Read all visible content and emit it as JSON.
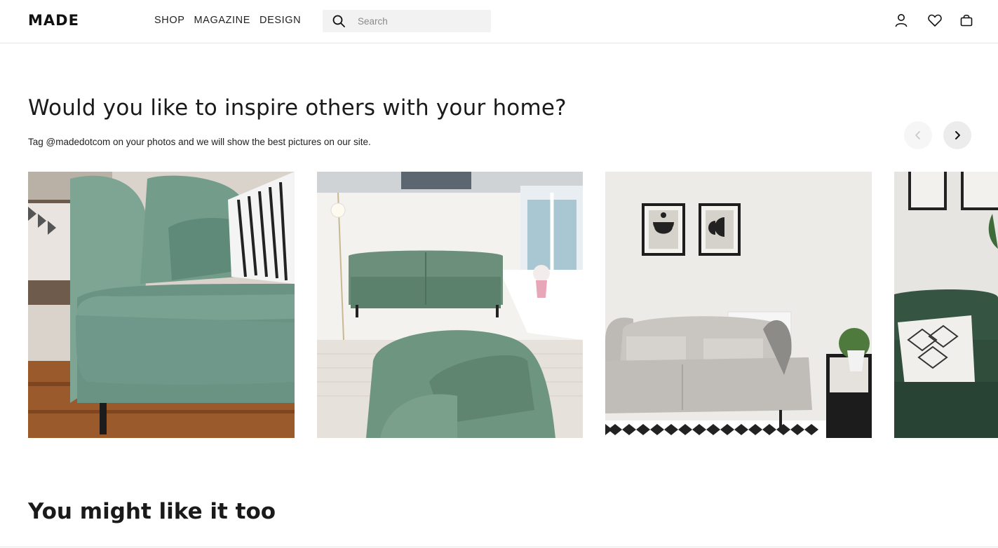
{
  "brand": {
    "logo": "MADE"
  },
  "nav": {
    "items": [
      "SHOP",
      "MAGAZINE",
      "DESIGN"
    ]
  },
  "search": {
    "placeholder": "Search",
    "value": ""
  },
  "header_icons": [
    "account-icon",
    "wishlist-heart-icon",
    "basket-icon"
  ],
  "inspire": {
    "title": "Would you like to inspire others with your home?",
    "subtitle": "Tag @madedotcom on your photos and we will show the best pictures on our site.",
    "photos": [
      "green-sofa-closeup",
      "green-sofa-conservatory",
      "grey-sofa-framed-prints",
      "green-sofa-patterned-cushion"
    ],
    "prev_disabled": true
  },
  "related": {
    "title": "You might like it too"
  },
  "colors": {
    "text": "#1a1a1a",
    "border": "#e6e6e6",
    "search_bg": "#f2f2f2",
    "sofa_green": "#6b9383"
  }
}
